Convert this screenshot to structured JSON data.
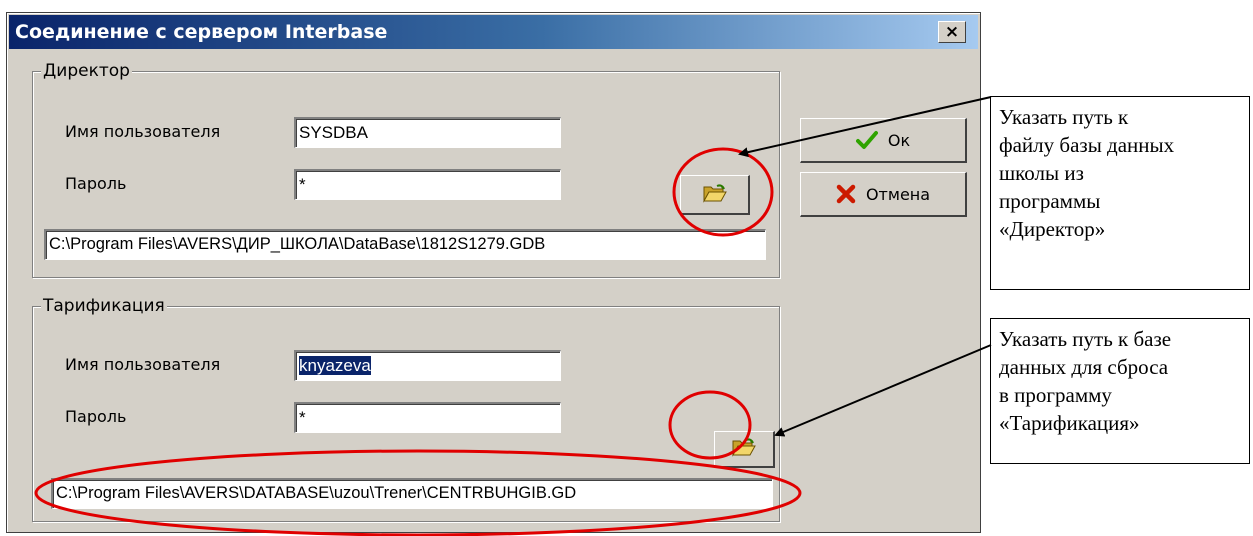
{
  "window": {
    "title": "Соединение с сервером Interbase",
    "close_label": "×"
  },
  "director": {
    "group_label": "Директор",
    "user_label": "Имя пользователя",
    "user_value": "SYSDBA",
    "password_label": "Пароль",
    "password_value": "*",
    "path_value": "C:\\Program Files\\AVERS\\ДИР_ШКОЛА\\DataBase\\1812S1279.GDB"
  },
  "tarification": {
    "group_label": "Тарификация",
    "user_label": "Имя пользователя",
    "user_value": "knyazeva",
    "password_label": "Пароль",
    "password_value": "*",
    "path_value": "C:\\Program Files\\AVERS\\DATABASE\\uzou\\Trener\\CENTRBUHGIB.GD"
  },
  "buttons": {
    "ok_label": "Ок",
    "cancel_label": "Отмена",
    "browse_icon": "folder-open-icon"
  },
  "callouts": {
    "director_lines": [
      "Указать путь к",
      "файлу базы данных",
      "школы из",
      "программы",
      "«Директор»"
    ],
    "tarification_lines": [
      "Указать путь к базе",
      "данных для сброса",
      "в программу",
      "«Тарификация»"
    ]
  },
  "colors": {
    "titlebar": "#0a246a",
    "selection": "#0a246a",
    "annotation_circle": "#e00000",
    "ok_check": "#2fa300",
    "cancel_x": "#cc1a00",
    "folder": "#e8c44a"
  }
}
